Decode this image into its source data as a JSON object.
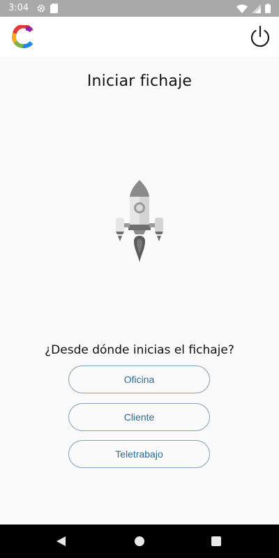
{
  "status_bar": {
    "time": "3:04",
    "left_icons": [
      "gear-icon",
      "sd-card-icon"
    ],
    "right_icons": [
      "wifi-icon",
      "signal-icon",
      "battery-icon"
    ]
  },
  "app_bar": {
    "logo_icon": "app-logo-icon",
    "power_icon": "power-icon"
  },
  "main": {
    "title": "Iniciar fichaje",
    "illustration_icon": "rocket-icon",
    "question": "¿Desde dónde inicias el fichaje?",
    "options": [
      {
        "label": "Oficina"
      },
      {
        "label": "Cliente"
      },
      {
        "label": "Teletrabajo"
      }
    ]
  },
  "nav_bar": {
    "icons": [
      "back-icon",
      "home-icon",
      "recent-apps-icon"
    ]
  },
  "colors": {
    "status_bar_bg": "#a9a9a9",
    "app_bar_bg": "#ffffff",
    "page_bg": "#fafafa",
    "button_border": "#7f9fba",
    "button_text": "#2b6a8f",
    "nav_bar_bg": "#000000"
  }
}
